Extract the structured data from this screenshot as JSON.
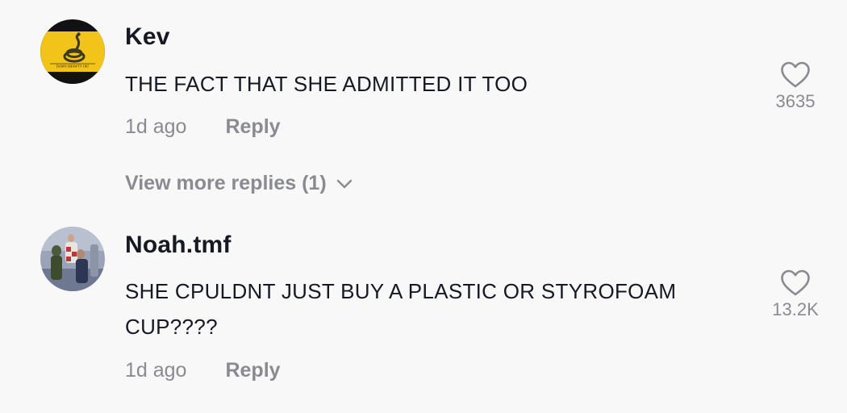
{
  "comments": [
    {
      "username": "Kev",
      "text": "THE FACT THAT SHE ADMITTED IT TOO",
      "time": "1d ago",
      "reply_label": "Reply",
      "likes": "3635",
      "avatar_caption": "DAMN SHAWTY OK!"
    },
    {
      "username": "Noah.tmf",
      "text": "SHE CPULDNT JUST BUY A PLASTIC OR STYROFOAM CUP????",
      "time": "1d ago",
      "reply_label": "Reply",
      "likes": "13.2K"
    }
  ],
  "view_more_replies": "View more replies (1)",
  "icons": {
    "like": "heart-outline-icon",
    "expand": "chevron-down-icon"
  },
  "colors": {
    "background": "#f8f8f8",
    "text_primary": "#161823",
    "text_secondary": "#8a8b91",
    "avatar_yellow": "#f2c318"
  }
}
